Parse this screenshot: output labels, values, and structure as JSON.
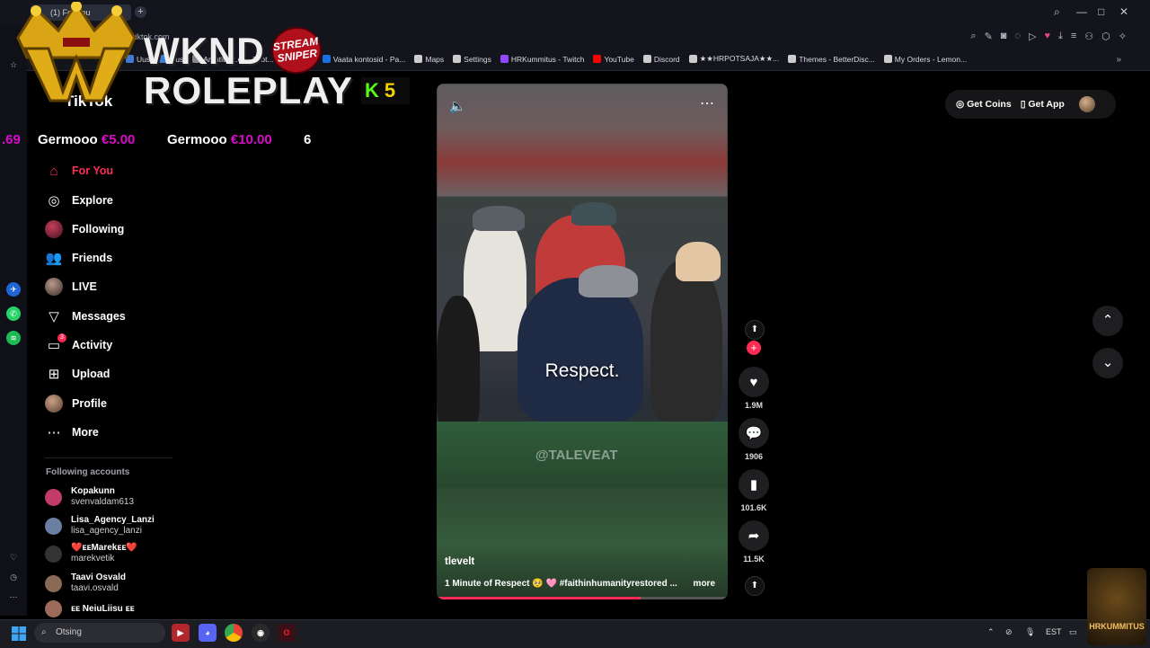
{
  "browser": {
    "tab_title": "(1) For You",
    "new_tab": "+",
    "url_text": "tiktok.com",
    "bookmarks": [
      {
        "label": "Uus",
        "color": "#3d7bd6"
      },
      {
        "label": "Uus",
        "color": "#3d7bd6"
      },
      {
        "label": "Arvutitark.ee - Toot...",
        "color": "#888"
      },
      {
        "label": "Gmail",
        "color": "#ccc"
      },
      {
        "label": "Vaata kontosid - Pa...",
        "color": "#1b6fe0"
      },
      {
        "label": "Maps",
        "color": "#ccc"
      },
      {
        "label": "Settings",
        "color": "#ccc"
      },
      {
        "label": "HRKummitus - Twitch",
        "color": "#9146ff"
      },
      {
        "label": "YouTube",
        "color": "#ff0000"
      },
      {
        "label": "Discord",
        "color": "#ccc"
      },
      {
        "label": "★★HRPOTSAJA★★...",
        "color": "#ccc"
      },
      {
        "label": "Themes - BetterDisc...",
        "color": "#ccc"
      },
      {
        "label": "My Orders - Lemon...",
        "color": "#ccc"
      }
    ],
    "window_controls": {
      "minimize": "—",
      "maximize": "□",
      "close": "✕"
    }
  },
  "overlay": {
    "wknd": "WKND",
    "roleplay": "ROLEPLAY",
    "sniper": "STREAM SNIPER",
    "kick_letter": "K",
    "kick_count": "5",
    "ticker_left": ".69",
    "ticker": [
      {
        "name": "Germooo",
        "amount": "€5.00"
      },
      {
        "name": "Germooo",
        "amount": "€10.00"
      }
    ],
    "ticker_tail": "6",
    "streamer_label": "HRKUMMITUS"
  },
  "sidebar": {
    "logo": "TikTok",
    "nav": [
      {
        "label": "For You",
        "icon": "home-icon"
      },
      {
        "label": "Explore",
        "icon": "compass-icon"
      },
      {
        "label": "Following",
        "icon": "following-avatar-icon"
      },
      {
        "label": "Friends",
        "icon": "friends-icon"
      },
      {
        "label": "LIVE",
        "icon": "live-avatar-icon"
      },
      {
        "label": "Messages",
        "icon": "send-icon"
      },
      {
        "label": "Activity",
        "icon": "activity-icon",
        "badge": "3"
      },
      {
        "label": "Upload",
        "icon": "upload-icon"
      },
      {
        "label": "Profile",
        "icon": "profile-avatar-icon"
      },
      {
        "label": "More",
        "icon": "more-icon"
      }
    ],
    "following_title": "Following accounts",
    "accounts": [
      {
        "name": "Kopakunn",
        "handle": "svenvaldam613",
        "color": "#c23b6a"
      },
      {
        "name": "Lisa_Agency_Lanzi",
        "handle": "lisa_agency_lanzi",
        "color": "#6b7fa3"
      },
      {
        "name": "❤️ᴇᴇMarekᴇᴇ❤️",
        "handle": "marekvetik",
        "color": "#333"
      },
      {
        "name": "Taavi Osvald",
        "handle": "taavi.osvald",
        "color": "#8a6a55"
      },
      {
        "name": "ᴇᴇ NeiuLiisu ᴇᴇ",
        "handle": "",
        "color": "#9c6b5a"
      }
    ]
  },
  "video": {
    "caption_word": "Respect.",
    "watermark": "@TALEVEAT",
    "author": "tlevelt",
    "description": "1 Minute of Respect 🥺 🩷 #faithinhumanityrestored ...",
    "more": "more",
    "progress": 0.7
  },
  "actions": {
    "likes": "1.9M",
    "comments": "1906",
    "saves": "101.6K",
    "shares": "11.5K"
  },
  "topbar": {
    "get_coins": "Get Coins",
    "get_app": "Get App"
  },
  "taskbar": {
    "search_placeholder": "Otsing",
    "lang": "EST"
  }
}
